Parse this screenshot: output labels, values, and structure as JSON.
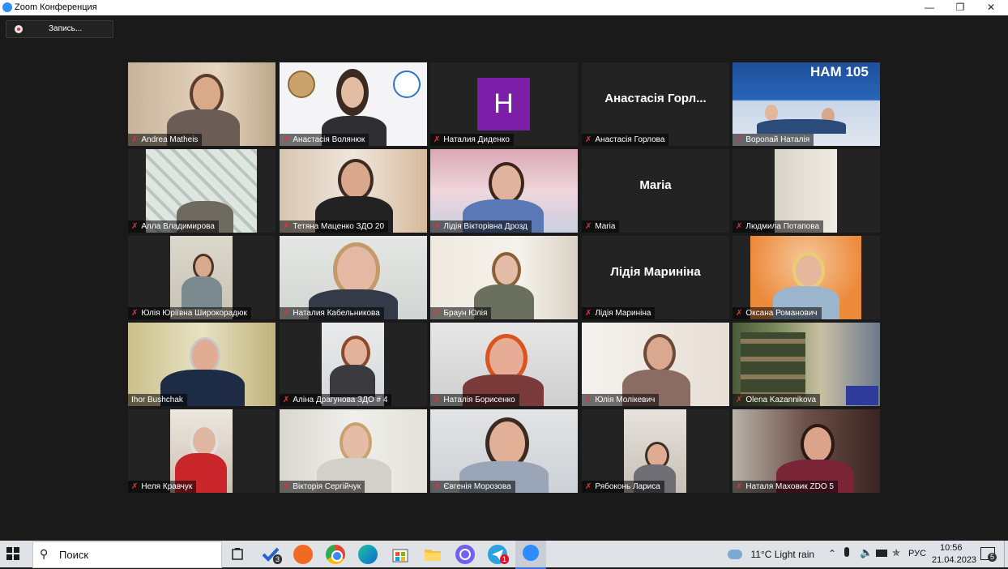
{
  "window": {
    "title": "Zoom Конференция"
  },
  "recording": {
    "label": "Запись..."
  },
  "participants": [
    {
      "name": "Andrea Matheis"
    },
    {
      "name": "Анастасія Волянюк"
    },
    {
      "name": "Наталия Диденко",
      "avatar_letter": "H"
    },
    {
      "name": "Анастасія Горлова",
      "display": "Анастасія Горл..."
    },
    {
      "name": "Воропай Наталія",
      "banner": "HAM 105"
    },
    {
      "name": "Алла Владимирова"
    },
    {
      "name": "Тетяна Маценко ЗДО 20"
    },
    {
      "name": "Лідія Вікторівна Дрозд"
    },
    {
      "name": "Maria",
      "display": "Maria"
    },
    {
      "name": "Людмила Потапова"
    },
    {
      "name": "Юлія Юріївна Широкорадюк"
    },
    {
      "name": "Наталия Кабельникова"
    },
    {
      "name": "Браун Юлія"
    },
    {
      "name": "Лідія Мариніна",
      "display": "Лідія Мариніна"
    },
    {
      "name": "Оксана Романович"
    },
    {
      "name": "Ihor Bushchak"
    },
    {
      "name": "Аліна Драгунова ЗДО # 4"
    },
    {
      "name": "Наталія Борисенко"
    },
    {
      "name": "Юлія Молікевич"
    },
    {
      "name": "Olena Kazannikova"
    },
    {
      "name": "Неля Кравчук"
    },
    {
      "name": "Вікторія Сергійчук"
    },
    {
      "name": "Євгенія  Морозова"
    },
    {
      "name": "Рябоконь Лариса"
    },
    {
      "name": "Наталя Маховик ZDO 5"
    }
  ],
  "taskbar": {
    "search_label": "Поиск",
    "weather": "11°C  Light rain",
    "language": "РУС",
    "time": "10:56",
    "date": "21.04.2023",
    "notifications": "5",
    "badge_todo": "3",
    "badge_mail": "1"
  }
}
